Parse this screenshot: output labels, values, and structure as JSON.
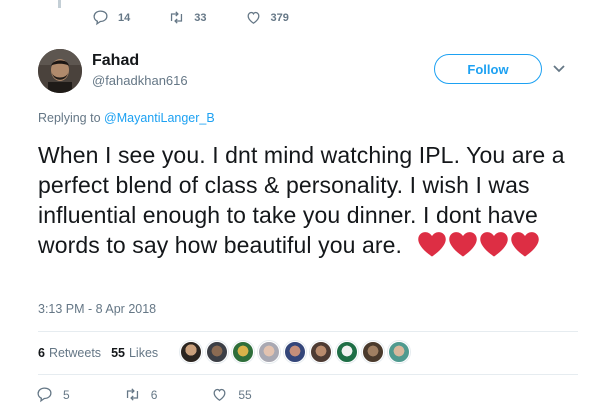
{
  "top_actions": {
    "reply_count": "14",
    "retweet_count": "33",
    "like_count": "379"
  },
  "author": {
    "name": "Fahad",
    "handle": "@fahadkhan616",
    "avatar_icon": "avatar-photo"
  },
  "follow_button": {
    "label": "Follow"
  },
  "reply_context": {
    "prefix": "Replying to",
    "mention": "@MayantiLanger_B"
  },
  "tweet": {
    "text": "When I see you. I dnt mind watching IPL. You are a perfect blend of class & personality. I wish I was influential enough to take you dinner. I dont have words to say how beautiful you are.",
    "emoji": [
      "heart",
      "heart",
      "heart",
      "heart"
    ],
    "timestamp": "3:13 PM - 8 Apr 2018"
  },
  "stats": {
    "retweets_count": "6",
    "retweets_label": "Retweets",
    "likes_count": "55",
    "likes_label": "Likes"
  },
  "likers_count_shown": 9,
  "bottom_actions": {
    "reply_count": "5",
    "retweet_count": "6",
    "like_count": "55"
  },
  "colors": {
    "accent": "#1da1f2",
    "muted_text": "#657786",
    "heart_red": "#dd2e44",
    "divider": "#e6ecf0"
  }
}
